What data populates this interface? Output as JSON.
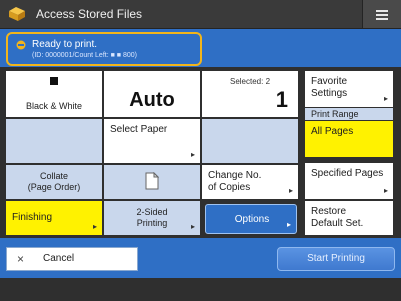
{
  "app": {
    "title": "Access Stored Files"
  },
  "status": {
    "line1": "Ready to print.",
    "line2": "(ID: 0000001/Count Left: ■ ■ 800)"
  },
  "mode": {
    "color_mode": "Black & White",
    "size": "Auto",
    "selected_label": "Selected: 2",
    "copies": "1"
  },
  "buttons": {
    "select_paper": "Select Paper",
    "collate": "Collate\n(Page Order)",
    "finishing": "Finishing",
    "two_sided": "2-Sided\nPrinting",
    "change_copies": "Change No.\nof Copies",
    "options": "Options",
    "favorite_settings": "Favorite\nSettings",
    "print_range": "Print Range",
    "all_pages": "All Pages",
    "specified_pages": "Specified Pages",
    "restore_default": "Restore\nDefault Set.",
    "cancel": "Cancel",
    "start_printing": "Start Printing"
  },
  "colors": {
    "accent_blue": "#2f6fc5",
    "highlight_yellow": "#fff200",
    "status_border": "#f2b51b"
  },
  "icons": {
    "app": "stored-files-icon",
    "menu": "menu-icon",
    "status": "ready-status-icon",
    "bw": "black-white-icon",
    "two_sided": "two-sided-icon",
    "cancel": "close-icon"
  }
}
